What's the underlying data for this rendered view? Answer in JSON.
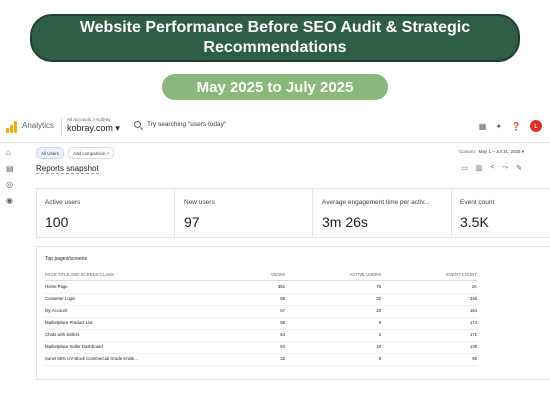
{
  "banner": {
    "title": "Website Performance Before SEO Audit & Strategic Recommendations"
  },
  "period": {
    "label": "May 2025 to July 2025"
  },
  "app": {
    "name": "Analytics",
    "breadcrumb": "All accounts > Kobray",
    "property": "kobray.com ▾",
    "search_placeholder": "Try searching \"users today\"",
    "avatar_initial": "L",
    "top_icons": [
      "apps-grid-icon",
      "sparkle-insights-icon",
      "help-icon"
    ]
  },
  "filters": {
    "all_users": "All Users",
    "add_comparison": "Add comparison +",
    "date_prefix": "Custom",
    "date_range": "May 1 – Jul 31, 2025 ▾"
  },
  "snapshot": {
    "title": "Reports snapshot",
    "icons": [
      "edit-report-icon",
      "compare-icon",
      "share-icon",
      "insights-icon",
      "customize-icon"
    ]
  },
  "metrics": [
    {
      "label": "Active users",
      "value": "100"
    },
    {
      "label": "New users",
      "value": "97"
    },
    {
      "label": "Average engagement time per activ...",
      "value": "3m 26s"
    },
    {
      "label": "Event count",
      "value": "3.5K"
    }
  ],
  "table": {
    "title": "Top pages/screens",
    "columns": [
      "PAGE TITLE AND SCREEN CLASS",
      "VIEWS",
      "ACTIVE USERS",
      "EVENT COUNT"
    ],
    "rows": [
      [
        "Home Page",
        "361",
        "75",
        "1K"
      ],
      [
        "Customer Login",
        "85",
        "32",
        "346"
      ],
      [
        "My Account",
        "67",
        "20",
        "164"
      ],
      [
        "Marketplace Product List",
        "58",
        "9",
        "174"
      ],
      [
        "Chats with Sellers",
        "54",
        "3",
        "171"
      ],
      [
        "Marketplace Seller Dashboard",
        "54",
        "10",
        "136"
      ],
      [
        "Sunet 85% UV Block Commercial Grade Knitte...",
        "32",
        "8",
        "95"
      ]
    ]
  },
  "colors": {
    "banner_bg": "#2e5e46",
    "pill_bg": "#8ab87b",
    "analytics_logo": "#f9ab00",
    "avatar_bg": "#d93025"
  }
}
